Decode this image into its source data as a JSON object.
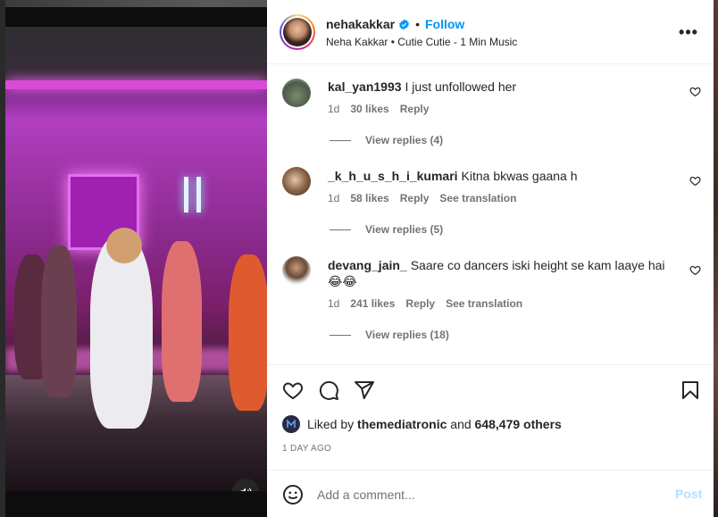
{
  "post": {
    "username": "nehakakkar",
    "follow_label": "Follow",
    "separator": "•",
    "audio_line": "Neha Kakkar • Cutie Cutie - 1 Min Music",
    "more_label": "•••"
  },
  "comments": [
    {
      "user": "kal_yan1993",
      "text": "I just unfollowed her",
      "age": "1d",
      "likes": "30 likes",
      "reply": "Reply",
      "translation": "",
      "view_replies": "View replies (4)"
    },
    {
      "user": "_k_h_u_s_h_i_kumari",
      "text": "Kitna bkwas gaana h",
      "age": "1d",
      "likes": "58 likes",
      "reply": "Reply",
      "translation": "See translation",
      "view_replies": "View replies (5)"
    },
    {
      "user": "devang_jain_",
      "text": "Saare co dancers iski height se kam laaye hai😂😂",
      "age": "1d",
      "likes": "241 likes",
      "reply": "Reply",
      "translation": "See translation",
      "view_replies": "View replies (18)"
    }
  ],
  "likes": {
    "prefix": "Liked by",
    "user": "themediatronic",
    "middle": "and",
    "count": "648,479 others"
  },
  "timestamp": "1 DAY AGO",
  "composer": {
    "placeholder": "Add a comment...",
    "post_label": "Post"
  },
  "colors": {
    "accent": "#0095f6",
    "post_disabled": "#b2dffc",
    "secondary_text": "#737373"
  },
  "icons": {
    "verified": "verified-badge-icon",
    "like": "heart-icon",
    "comment": "comment-icon",
    "share": "share-icon",
    "save": "bookmark-icon",
    "emoji": "emoji-icon",
    "audio": "speaker-icon"
  }
}
